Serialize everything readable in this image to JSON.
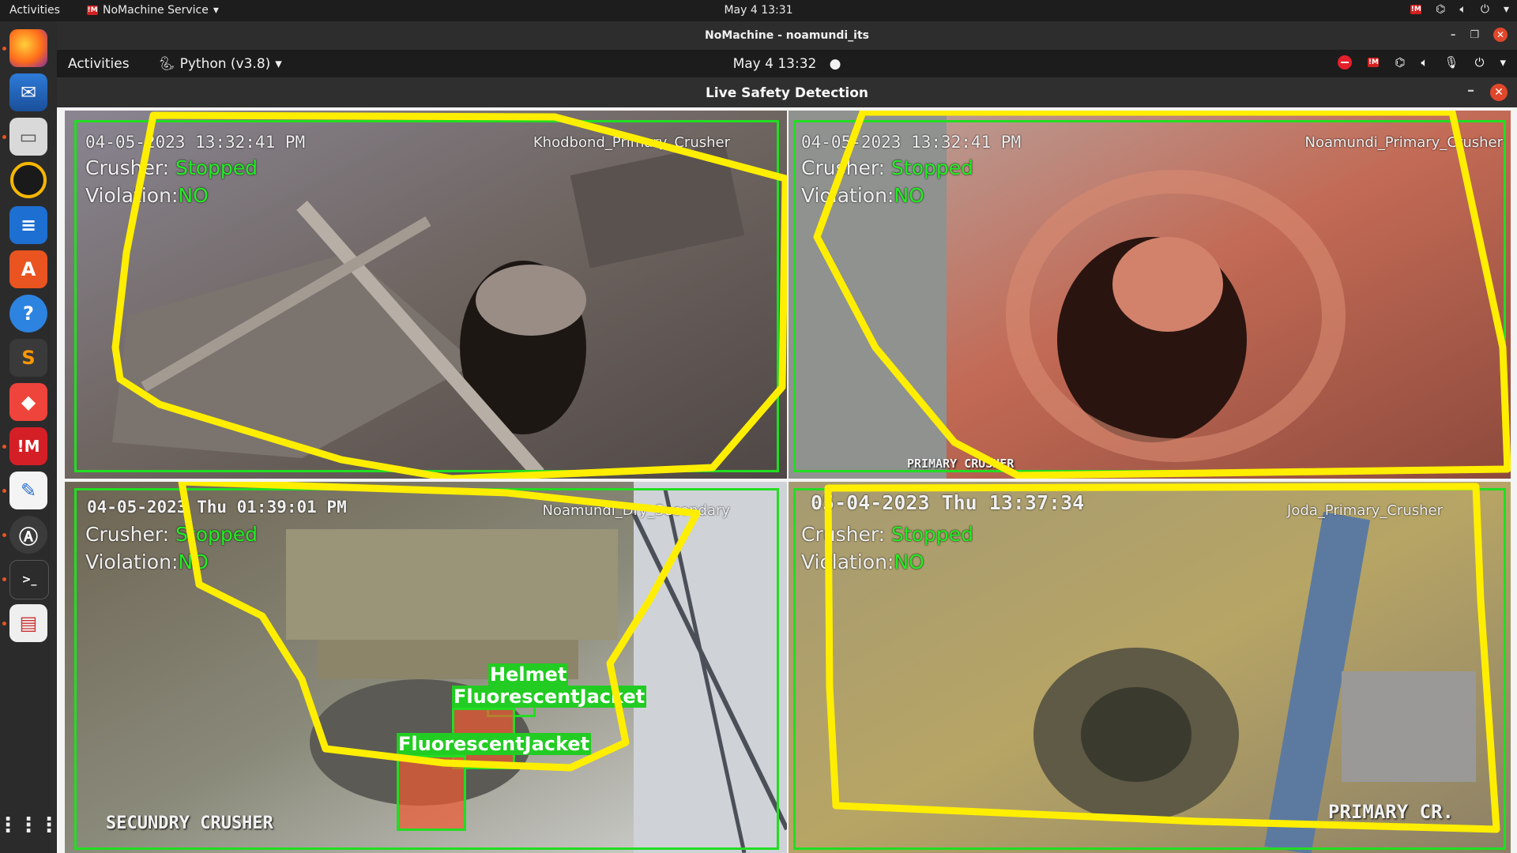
{
  "system_bar": {
    "activities": "Activities",
    "app_name": "NoMachine Service",
    "clock": "May 4  13:31"
  },
  "nomachine_window": {
    "title": "NoMachine - noamundi_its"
  },
  "remote_bar": {
    "activities": "Activities",
    "app_name": "Python (v3.8)",
    "clock": "May 4  13:32"
  },
  "app_window": {
    "title": "Live Safety Detection"
  },
  "cameras": [
    {
      "timestamp": "04-05-2023 13:32:41    PM",
      "name": "Khodbond_Primary_Crusher",
      "crusher_label": "Crusher:",
      "crusher_status": "Stopped",
      "violation_label": "Violation:",
      "violation_value": "NO"
    },
    {
      "timestamp": "04-05-2023 13:32:41    PM",
      "name": "Noamundi_Primary_Crusher",
      "crusher_label": "Crusher:",
      "crusher_status": "Stopped",
      "violation_label": "Violation:",
      "violation_value": "NO",
      "stamp": "PRIMARY CRUSHER"
    },
    {
      "timestamp": "04-05-2023  Thu  01:39:01 PM",
      "name": "Noamundi_Dry_Secondary",
      "crusher_label": "Crusher:",
      "crusher_status": "Stopped",
      "violation_label": "Violation:",
      "violation_value": "NO",
      "stamp": "SECUNDRY CRUSHER",
      "detections": [
        "Helmet",
        "FluorescentJacket",
        "FluorescentJacket"
      ]
    },
    {
      "timestamp": "05-04-2023  Thu  13:37:34",
      "name": "Joda_Primary_Crusher",
      "crusher_label": "Crusher:",
      "crusher_status": "Stopped",
      "violation_label": "Violation:",
      "violation_value": "NO",
      "stamp": "PRIMARY CR."
    }
  ],
  "colors": {
    "zone": "#ffee00",
    "frame": "#22dd22",
    "status": "#22ee22",
    "close": "#e0472b"
  },
  "dock_icons": [
    "firefox-icon",
    "thunderbird-icon",
    "files-icon",
    "rhythmbox-icon",
    "writer-icon",
    "software-icon",
    "help-icon",
    "sublime-icon",
    "anydesk-icon",
    "nomachine-icon",
    "text-editor-icon",
    "updater-icon",
    "terminal-icon",
    "document-viewer-icon",
    "app-grid-icon"
  ]
}
